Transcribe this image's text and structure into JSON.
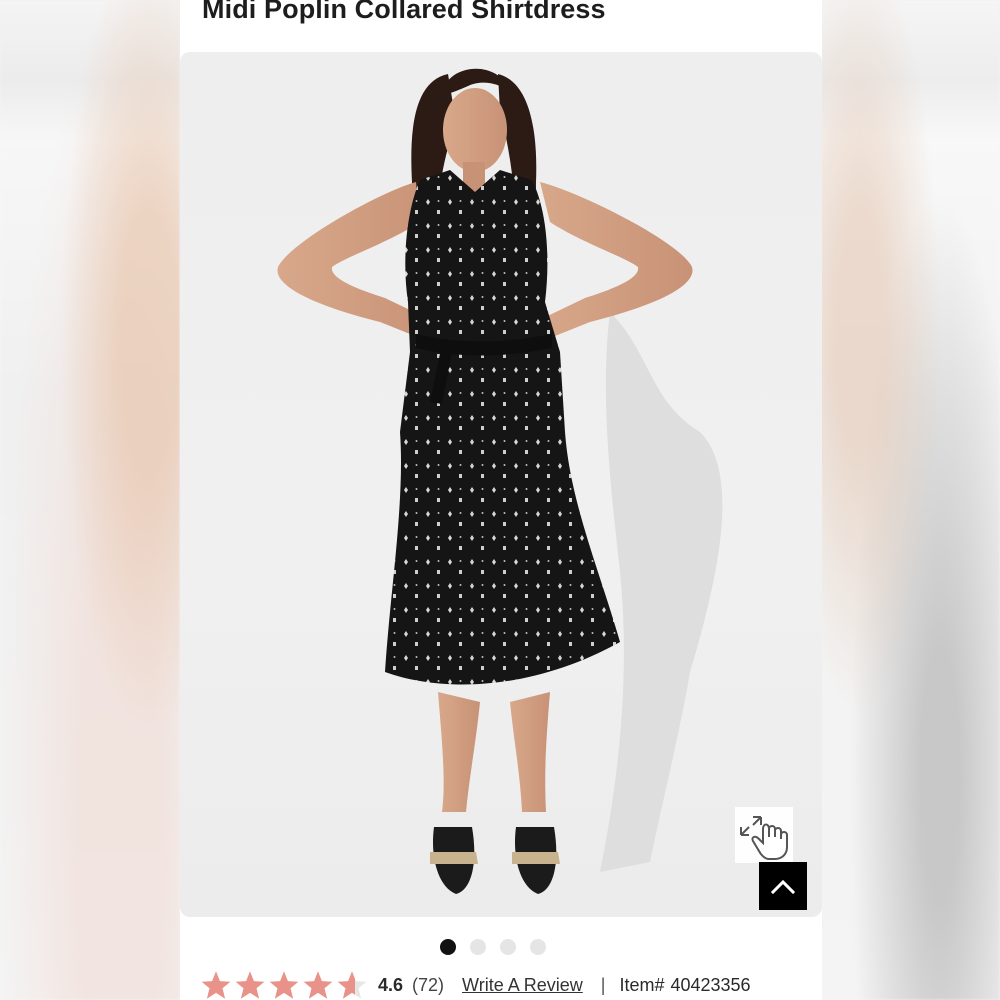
{
  "product": {
    "title": "Midi Poplin Collared Shirtdress",
    "image_alt": "Model wearing black sleeveless midi shirtdress with white geometric print and strappy black platform sandals",
    "carousel": {
      "dot_count": 4,
      "active_index": 0
    },
    "rating": {
      "value": "4.6",
      "count": "(72)",
      "stars_fraction": 0.92,
      "star_color": "#e8928a"
    },
    "write_review_label": "Write A Review",
    "separator": "|",
    "item_label": "Item#",
    "item_number": "40423356"
  },
  "controls": {
    "zoom_icon": "tap-zoom-icon",
    "scroll_top_icon": "chevron-up-icon"
  }
}
